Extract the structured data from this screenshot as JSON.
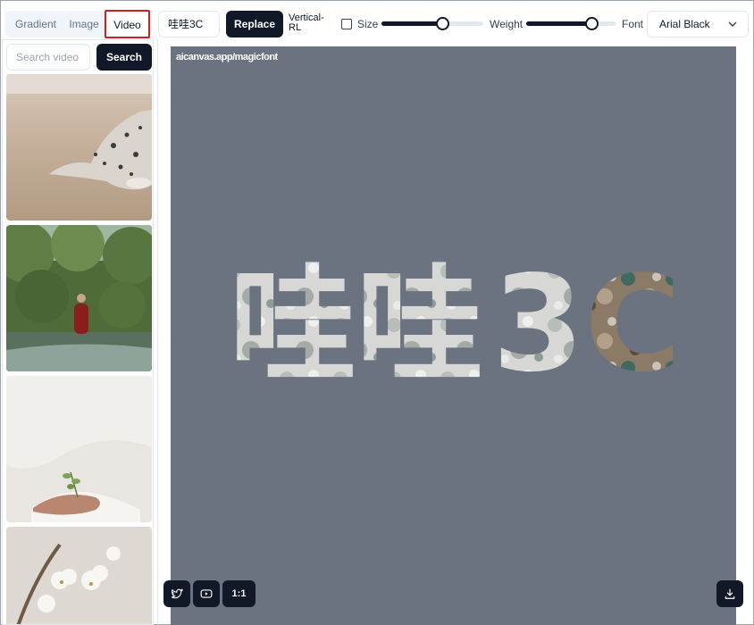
{
  "tabs": {
    "gradient": "Gradient",
    "image": "Image",
    "video": "Video"
  },
  "text_input": {
    "value": "哇哇3C"
  },
  "buttons": {
    "replace": "Replace",
    "search": "Search",
    "ratio": "1:1"
  },
  "vertical_label": {
    "line1": "Vertical-",
    "line2": "RL"
  },
  "size_label": "Size",
  "weight_label": "Weight",
  "font_label": "Font",
  "font_select": {
    "value": "Arial Black"
  },
  "sliders": {
    "size": 0.6,
    "weight": 0.73
  },
  "search": {
    "placeholder": "Search video"
  },
  "canvas": {
    "watermark": "aicanvas.app/magicfont",
    "text": "哇哇3C",
    "background": "#6b7280"
  },
  "colors": {
    "accent_dark": "#111827",
    "highlight": "#cc1f1f"
  },
  "icons": [
    "twitter-icon",
    "youtube-icon",
    "download-icon",
    "chevron-down-icon"
  ]
}
